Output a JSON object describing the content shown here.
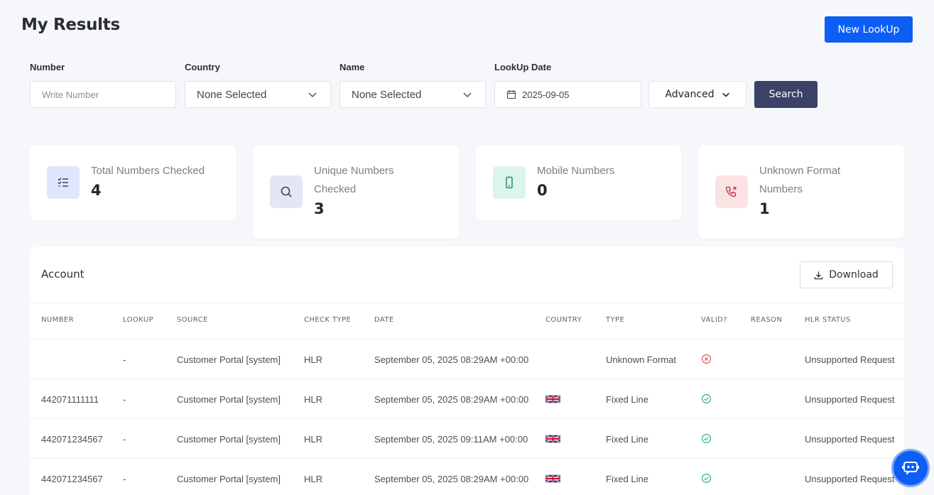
{
  "header": {
    "title": "My Results",
    "new_lookup_label": "New LookUp"
  },
  "filters": {
    "number": {
      "label": "Number",
      "placeholder": "Write Number"
    },
    "country": {
      "label": "Country",
      "value": "None Selected"
    },
    "name": {
      "label": "Name",
      "value": "None Selected"
    },
    "lookup_date": {
      "label": "LookUp Date",
      "value": "2025-09-05"
    },
    "advanced_label": "Advanced",
    "search_label": "Search"
  },
  "stats": [
    {
      "label": "Total Numbers Checked",
      "value": "4",
      "icon": "checklist-icon",
      "color": "#dfe7fb"
    },
    {
      "label": "Unique Numbers Checked",
      "value": "3",
      "icon": "search-icon",
      "color": "#e3e6f4"
    },
    {
      "label": "Mobile Numbers",
      "value": "0",
      "icon": "mobile-phone-icon",
      "color": "#dcf4ea"
    },
    {
      "label": "Unknown Format Numbers",
      "value": "1",
      "icon": "phone-x-icon",
      "color": "#fbe3e5"
    }
  ],
  "table": {
    "title": "Account",
    "download_label": "Download",
    "columns": [
      "NUMBER",
      "LOOKUP",
      "SOURCE",
      "CHECK TYPE",
      "DATE",
      "COUNTRY",
      "TYPE",
      "VALID?",
      "REASON",
      "HLR STATUS"
    ],
    "rows": [
      {
        "number": "",
        "lookup": "-",
        "source": "Customer Portal [system]",
        "check_type": "HLR",
        "date": "September 05, 2025 08:29AM +00:00",
        "country": "",
        "type": "Unknown Format",
        "valid": "invalid",
        "reason": "",
        "hlr_status": "Unsupported Request"
      },
      {
        "number": "442071111111",
        "lookup": "-",
        "source": "Customer Portal [system]",
        "check_type": "HLR",
        "date": "September 05, 2025 08:29AM +00:00",
        "country": "uk-flag-icon",
        "type": "Fixed Line",
        "valid": "valid",
        "reason": "",
        "hlr_status": "Unsupported Request"
      },
      {
        "number": "442071234567",
        "lookup": "-",
        "source": "Customer Portal [system]",
        "check_type": "HLR",
        "date": "September 05, 2025 09:11AM +00:00",
        "country": "uk-flag-icon",
        "type": "Fixed Line",
        "valid": "valid",
        "reason": "",
        "hlr_status": "Unsupported Request"
      },
      {
        "number": "442071234567",
        "lookup": "-",
        "source": "Customer Portal [system]",
        "check_type": "HLR",
        "date": "September 05, 2025 08:29AM +00:00",
        "country": "uk-flag-icon",
        "type": "Fixed Line",
        "valid": "valid",
        "reason": "",
        "hlr_status": "Unsupported Request"
      }
    ]
  },
  "colors": {
    "primary": "#0d5ef4",
    "search_button": "#3b4266",
    "valid": "#2fb48a",
    "invalid": "#e05560"
  }
}
